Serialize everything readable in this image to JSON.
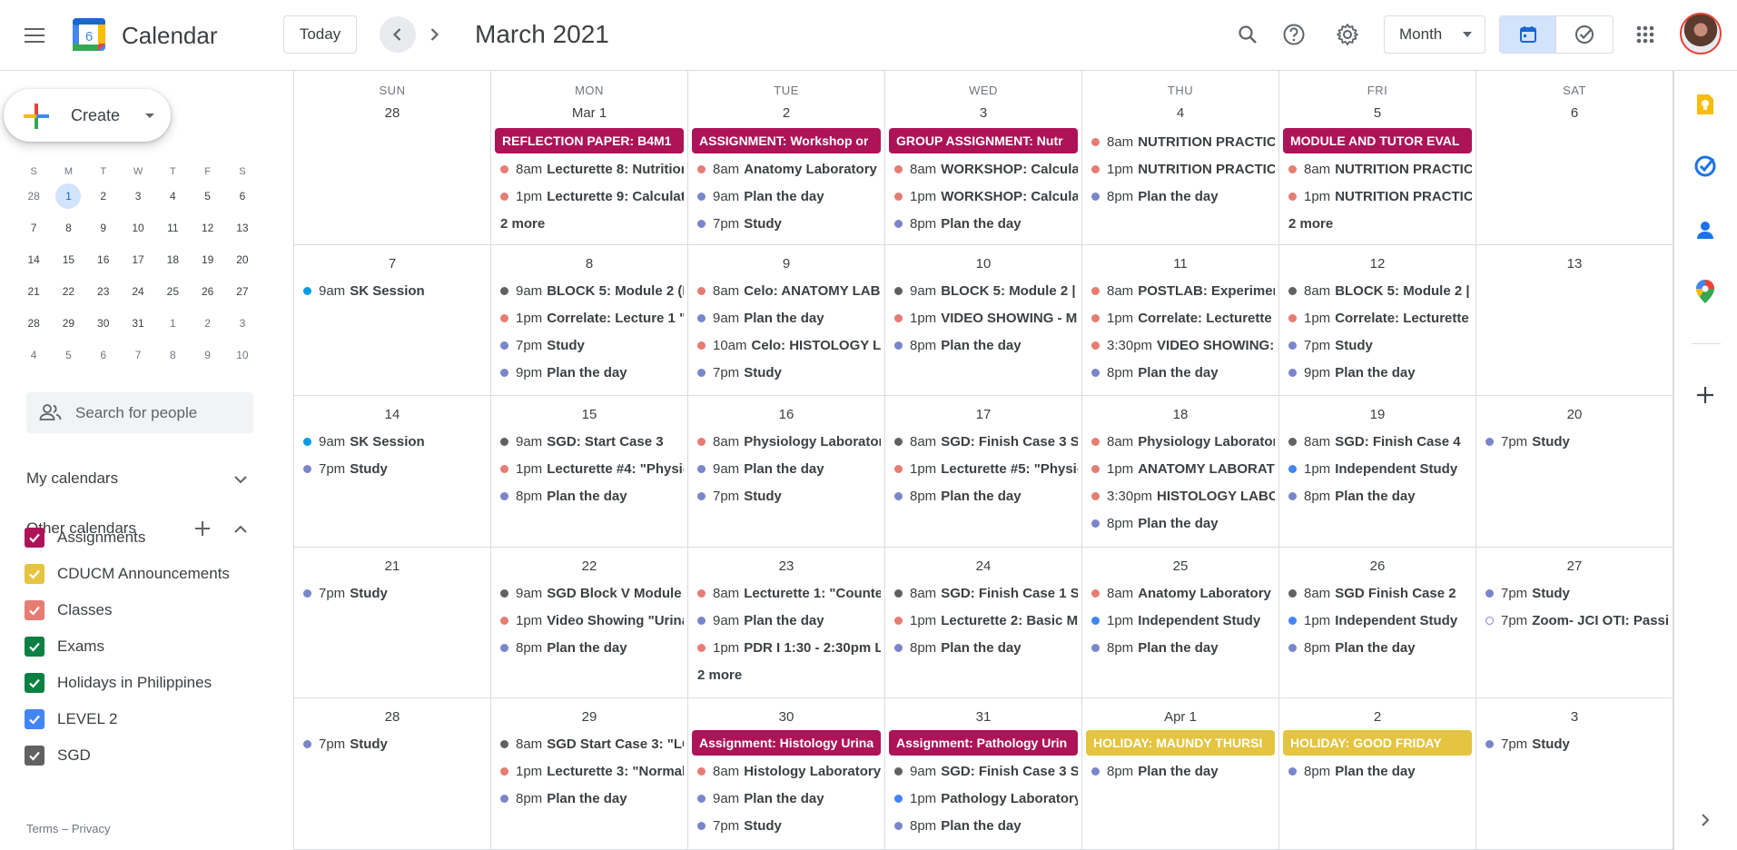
{
  "header": {
    "app_name": "Calendar",
    "logo_day": "6",
    "today_label": "Today",
    "month_title": "March 2021",
    "view_label": "Month"
  },
  "sidebar": {
    "create_label": "Create",
    "mini_cal": {
      "dow": [
        "S",
        "M",
        "T",
        "W",
        "T",
        "F",
        "S"
      ],
      "weeks": [
        [
          "28",
          "1",
          "2",
          "3",
          "4",
          "5",
          "6"
        ],
        [
          "7",
          "8",
          "9",
          "10",
          "11",
          "12",
          "13"
        ],
        [
          "14",
          "15",
          "16",
          "17",
          "18",
          "19",
          "20"
        ],
        [
          "21",
          "22",
          "23",
          "24",
          "25",
          "26",
          "27"
        ],
        [
          "28",
          "29",
          "30",
          "31",
          "1",
          "2",
          "3"
        ],
        [
          "4",
          "5",
          "6",
          "7",
          "8",
          "9",
          "10"
        ]
      ],
      "selected": "1"
    },
    "search_placeholder": "Search for people",
    "my_calendars": "My calendars",
    "other_calendars": "Other calendars",
    "calendars": [
      {
        "label": "Assignments",
        "color": "#ad1457"
      },
      {
        "label": "CDUCM Announcements",
        "color": "#e4c441"
      },
      {
        "label": "Classes",
        "color": "#e67c73"
      },
      {
        "label": "Exams",
        "color": "#0b8043"
      },
      {
        "label": "Holidays in Philippines",
        "color": "#0b8043"
      },
      {
        "label": "LEVEL 2",
        "color": "#4285f4"
      },
      {
        "label": "SGD",
        "color": "#616161"
      }
    ],
    "terms": "Terms",
    "dash": "–",
    "privacy": "Privacy"
  },
  "colors": {
    "assignment": "#ad1457",
    "classes": "#e67c73",
    "study": "#7986cb",
    "sgd": "#616161",
    "level2": "#4285f4",
    "sk": "#039be5",
    "holiday": "#e4c441"
  },
  "grid": {
    "dow": [
      "SUN",
      "MON",
      "TUE",
      "WED",
      "THU",
      "FRI",
      "SAT"
    ],
    "weeks": [
      [
        {
          "date": "28",
          "events": []
        },
        {
          "date": "Mar 1",
          "events": [
            {
              "type": "block",
              "title": "REFLECTION PAPER: B4M1",
              "color": "assignment"
            },
            {
              "time": "8am",
              "title": "Lecturette 8: Nutrition",
              "color": "classes"
            },
            {
              "time": "1pm",
              "title": "Lecturette 9: Calculat",
              "color": "classes"
            },
            {
              "type": "more",
              "title": "2 more"
            }
          ]
        },
        {
          "date": "2",
          "events": [
            {
              "type": "block",
              "title": "ASSIGNMENT: Workshop or",
              "color": "assignment"
            },
            {
              "time": "8am",
              "title": "Anatomy Laboratory",
              "color": "classes"
            },
            {
              "time": "9am",
              "title": "Plan the day",
              "color": "study"
            },
            {
              "time": "7pm",
              "title": "Study",
              "color": "study"
            }
          ]
        },
        {
          "date": "3",
          "events": [
            {
              "type": "block",
              "title": "GROUP ASSIGNMENT: Nutr",
              "color": "assignment"
            },
            {
              "time": "8am",
              "title": "WORKSHOP: Calculat",
              "color": "classes"
            },
            {
              "time": "1pm",
              "title": "WORKSHOP: Calculat",
              "color": "classes"
            },
            {
              "time": "8pm",
              "title": "Plan the day",
              "color": "study"
            }
          ]
        },
        {
          "date": "4",
          "events": [
            {
              "time": "8am",
              "title": "NUTRITION PRACTIC",
              "color": "classes"
            },
            {
              "time": "1pm",
              "title": "NUTRITION PRACTIC",
              "color": "classes"
            },
            {
              "time": "8pm",
              "title": "Plan the day",
              "color": "study"
            }
          ]
        },
        {
          "date": "5",
          "events": [
            {
              "type": "block",
              "title": "MODULE AND TUTOR EVAL",
              "color": "assignment"
            },
            {
              "time": "8am",
              "title": "NUTRITION PRACTIC",
              "color": "classes"
            },
            {
              "time": "1pm",
              "title": "NUTRITION PRACTIC",
              "color": "classes"
            },
            {
              "type": "more",
              "title": "2 more"
            }
          ]
        },
        {
          "date": "6",
          "events": []
        }
      ],
      [
        {
          "date": "7",
          "events": [
            {
              "time": "9am",
              "title": "SK Session",
              "color": "sk"
            }
          ]
        },
        {
          "date": "8",
          "events": [
            {
              "time": "9am",
              "title": "BLOCK 5: Module 2 (F",
              "color": "sgd"
            },
            {
              "time": "1pm",
              "title": "Correlate: Lecture 1 \"I",
              "color": "classes"
            },
            {
              "time": "7pm",
              "title": "Study",
              "color": "study"
            },
            {
              "time": "9pm",
              "title": "Plan the day",
              "color": "study"
            }
          ]
        },
        {
          "date": "9",
          "events": [
            {
              "time": "8am",
              "title": "Celo: ANATOMY LABO",
              "color": "classes"
            },
            {
              "time": "9am",
              "title": "Plan the day",
              "color": "study"
            },
            {
              "time": "10am",
              "title": "Celo: HISTOLOGY LA",
              "color": "classes"
            },
            {
              "time": "7pm",
              "title": "Study",
              "color": "study"
            }
          ]
        },
        {
          "date": "10",
          "events": [
            {
              "time": "9am",
              "title": "BLOCK 5: Module 2 | S",
              "color": "sgd"
            },
            {
              "time": "1pm",
              "title": "VIDEO SHOWING - Mo",
              "color": "classes"
            },
            {
              "time": "8pm",
              "title": "Plan the day",
              "color": "study"
            }
          ]
        },
        {
          "date": "11",
          "events": [
            {
              "time": "8am",
              "title": "POSTLAB: Experimen",
              "color": "classes"
            },
            {
              "time": "1pm",
              "title": "Correlate: Lecturette",
              "color": "classes"
            },
            {
              "time": "3:30pm",
              "title": "VIDEO SHOWING:",
              "color": "classes"
            },
            {
              "time": "8pm",
              "title": "Plan the day",
              "color": "study"
            }
          ]
        },
        {
          "date": "12",
          "events": [
            {
              "time": "8am",
              "title": "BLOCK 5: Module 2 | I",
              "color": "sgd"
            },
            {
              "time": "1pm",
              "title": "Correlate: Lecturette",
              "color": "classes"
            },
            {
              "time": "7pm",
              "title": "Study",
              "color": "study"
            },
            {
              "time": "9pm",
              "title": "Plan the day",
              "color": "study"
            }
          ]
        },
        {
          "date": "13",
          "events": []
        }
      ],
      [
        {
          "date": "14",
          "events": [
            {
              "time": "9am",
              "title": "SK Session",
              "color": "sk"
            },
            {
              "time": "7pm",
              "title": "Study",
              "color": "study"
            }
          ]
        },
        {
          "date": "15",
          "events": [
            {
              "time": "9am",
              "title": "SGD: Start Case 3",
              "color": "sgd"
            },
            {
              "time": "1pm",
              "title": "Lecturette #4: \"Physio",
              "color": "classes"
            },
            {
              "time": "8pm",
              "title": "Plan the day",
              "color": "study"
            }
          ]
        },
        {
          "date": "16",
          "events": [
            {
              "time": "8am",
              "title": "Physiology Laborator",
              "color": "classes"
            },
            {
              "time": "9am",
              "title": "Plan the day",
              "color": "study"
            },
            {
              "time": "7pm",
              "title": "Study",
              "color": "study"
            }
          ]
        },
        {
          "date": "17",
          "events": [
            {
              "time": "8am",
              "title": "SGD: Finish Case 3 ST",
              "color": "sgd"
            },
            {
              "time": "1pm",
              "title": "Lecturette #5: \"Physio",
              "color": "classes"
            },
            {
              "time": "8pm",
              "title": "Plan the day",
              "color": "study"
            }
          ]
        },
        {
          "date": "18",
          "events": [
            {
              "time": "8am",
              "title": "Physiology Laborator",
              "color": "classes"
            },
            {
              "time": "1pm",
              "title": "ANATOMY LABORATO",
              "color": "classes"
            },
            {
              "time": "3:30pm",
              "title": "HISTOLOGY LABO",
              "color": "classes"
            },
            {
              "time": "8pm",
              "title": "Plan the day",
              "color": "study"
            }
          ]
        },
        {
          "date": "19",
          "events": [
            {
              "time": "8am",
              "title": "SGD: Finish Case 4",
              "color": "sgd"
            },
            {
              "time": "1pm",
              "title": "Independent Study",
              "color": "level2"
            },
            {
              "time": "8pm",
              "title": "Plan the day",
              "color": "study"
            }
          ]
        },
        {
          "date": "20",
          "events": [
            {
              "time": "7pm",
              "title": "Study",
              "color": "study"
            }
          ]
        }
      ],
      [
        {
          "date": "21",
          "events": [
            {
              "time": "7pm",
              "title": "Study",
              "color": "study"
            }
          ]
        },
        {
          "date": "22",
          "events": [
            {
              "time": "9am",
              "title": "SGD Block V Module",
              "color": "sgd"
            },
            {
              "time": "1pm",
              "title": "Video Showing \"Urina",
              "color": "classes"
            },
            {
              "time": "8pm",
              "title": "Plan the day",
              "color": "study"
            }
          ]
        },
        {
          "date": "23",
          "events": [
            {
              "time": "8am",
              "title": "Lecturette 1: \"Counte",
              "color": "classes"
            },
            {
              "time": "9am",
              "title": "Plan the day",
              "color": "study"
            },
            {
              "time": "1pm",
              "title": "PDR I 1:30 - 2:30pm L",
              "color": "classes"
            },
            {
              "type": "more",
              "title": "2 more"
            }
          ]
        },
        {
          "date": "24",
          "events": [
            {
              "time": "8am",
              "title": "SGD: Finish Case 1 St",
              "color": "sgd"
            },
            {
              "time": "1pm",
              "title": "Lecturette 2: Basic M",
              "color": "classes"
            },
            {
              "time": "8pm",
              "title": "Plan the day",
              "color": "study"
            }
          ]
        },
        {
          "date": "25",
          "events": [
            {
              "time": "8am",
              "title": "Anatomy Laboratory",
              "color": "classes"
            },
            {
              "time": "1pm",
              "title": "Independent Study",
              "color": "level2"
            },
            {
              "time": "8pm",
              "title": "Plan the day",
              "color": "study"
            }
          ]
        },
        {
          "date": "26",
          "events": [
            {
              "time": "8am",
              "title": "SGD Finish Case 2",
              "color": "sgd"
            },
            {
              "time": "1pm",
              "title": "Independent Study",
              "color": "level2"
            },
            {
              "time": "8pm",
              "title": "Plan the day",
              "color": "study"
            }
          ]
        },
        {
          "date": "27",
          "events": [
            {
              "time": "7pm",
              "title": "Study",
              "color": "study"
            },
            {
              "time": "7pm",
              "title": "Zoom- JCI OTI: Passio",
              "color": "study",
              "hollow": true
            }
          ]
        }
      ],
      [
        {
          "date": "28",
          "events": [
            {
              "time": "7pm",
              "title": "Study",
              "color": "study"
            }
          ]
        },
        {
          "date": "29",
          "events": [
            {
              "time": "8am",
              "title": "SGD Start Case 3: \"LC",
              "color": "sgd"
            },
            {
              "time": "1pm",
              "title": "Lecturette 3: \"Normal",
              "color": "classes"
            },
            {
              "time": "8pm",
              "title": "Plan the day",
              "color": "study"
            }
          ]
        },
        {
          "date": "30",
          "events": [
            {
              "type": "block",
              "title": "Assignment: Histology Urina",
              "color": "assignment"
            },
            {
              "time": "8am",
              "title": "Histology Laboratory",
              "color": "classes"
            },
            {
              "time": "9am",
              "title": "Plan the day",
              "color": "study"
            },
            {
              "time": "7pm",
              "title": "Study",
              "color": "study"
            }
          ]
        },
        {
          "date": "31",
          "events": [
            {
              "type": "block",
              "title": "Assignment: Pathology Urin",
              "color": "assignment"
            },
            {
              "time": "9am",
              "title": "SGD: Finish Case 3 St",
              "color": "sgd"
            },
            {
              "time": "1pm",
              "title": "Pathology Laboratory",
              "color": "level2"
            },
            {
              "time": "8pm",
              "title": "Plan the day",
              "color": "study"
            }
          ]
        },
        {
          "date": "Apr 1",
          "events": [
            {
              "type": "block",
              "title": "HOLIDAY: MAUNDY THURSI",
              "color": "holiday"
            },
            {
              "time": "8pm",
              "title": "Plan the day",
              "color": "study"
            }
          ]
        },
        {
          "date": "2",
          "events": [
            {
              "type": "block",
              "title": "HOLIDAY: GOOD FRIDAY",
              "color": "holiday"
            },
            {
              "time": "8pm",
              "title": "Plan the day",
              "color": "study"
            }
          ]
        },
        {
          "date": "3",
          "events": [
            {
              "time": "7pm",
              "title": "Study",
              "color": "study"
            }
          ]
        }
      ]
    ]
  }
}
